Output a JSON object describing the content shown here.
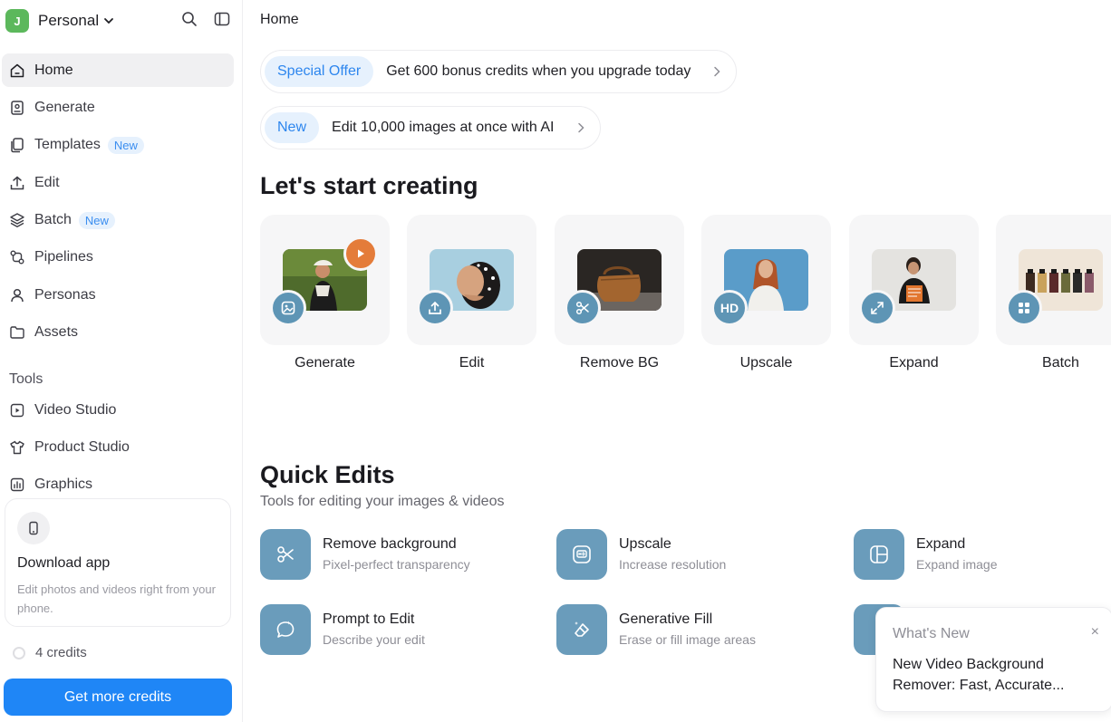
{
  "workspace": {
    "initial": "J",
    "name": "Personal"
  },
  "nav": [
    {
      "label": "Home",
      "icon": "home-icon",
      "active": true
    },
    {
      "label": "Generate",
      "icon": "image-generate-icon"
    },
    {
      "label": "Templates",
      "icon": "templates-icon",
      "badge": "New"
    },
    {
      "label": "Edit",
      "icon": "upload-icon"
    },
    {
      "label": "Batch",
      "icon": "layers-icon",
      "badge": "New"
    },
    {
      "label": "Pipelines",
      "icon": "pipelines-icon"
    },
    {
      "label": "Personas",
      "icon": "person-icon"
    },
    {
      "label": "Assets",
      "icon": "folder-icon"
    }
  ],
  "tools": {
    "heading": "Tools",
    "items": [
      {
        "label": "Video Studio",
        "icon": "video-icon"
      },
      {
        "label": "Product Studio",
        "icon": "shirt-icon"
      },
      {
        "label": "Graphics",
        "icon": "graphics-icon"
      }
    ]
  },
  "download_app": {
    "title": "Download app",
    "description": "Edit photos and videos right from your phone."
  },
  "credits": {
    "text": "4 credits",
    "button": "Get more credits"
  },
  "main": {
    "breadcrumb": "Home",
    "promos": [
      {
        "tag": "Special Offer",
        "text": "Get 600 bonus credits when you upgrade today"
      },
      {
        "tag": "New",
        "text": "Edit 10,000 images at once with AI"
      }
    ],
    "start_heading": "Let's start creating",
    "cards": [
      {
        "label": "Generate",
        "icon": "image-icon"
      },
      {
        "label": "Edit",
        "icon": "upload-icon"
      },
      {
        "label": "Remove BG",
        "icon": "scissors-icon"
      },
      {
        "label": "Upscale",
        "icon": "hd-icon",
        "icon_text": "HD"
      },
      {
        "label": "Expand",
        "icon": "expand-icon"
      },
      {
        "label": "Batch",
        "icon": "grid-icon"
      }
    ],
    "quick_heading": "Quick Edits",
    "quick_sub": "Tools for editing your images & videos",
    "quick_edits": [
      {
        "name": "Remove background",
        "desc": "Pixel-perfect transparency",
        "icon": "scissors-icon"
      },
      {
        "name": "Upscale",
        "desc": "Increase resolution",
        "icon": "hd-icon"
      },
      {
        "name": "Expand",
        "desc": "Expand image",
        "icon": "expand-frame-icon"
      },
      {
        "name": "Prompt to Edit",
        "desc": "Describe your edit",
        "icon": "chat-bubble-icon"
      },
      {
        "name": "Generative Fill",
        "desc": "Erase or fill image areas",
        "icon": "eraser-icon"
      }
    ]
  },
  "whats_new": {
    "heading": "What's New",
    "close": "×",
    "text": "New Video Background Remover: Fast, Accurate..."
  },
  "colors": {
    "accent": "#1f86f6",
    "icon_tile": "#6a9cbb",
    "badge_bg": "#e6f1fd",
    "badge_text": "#2d86ee"
  }
}
